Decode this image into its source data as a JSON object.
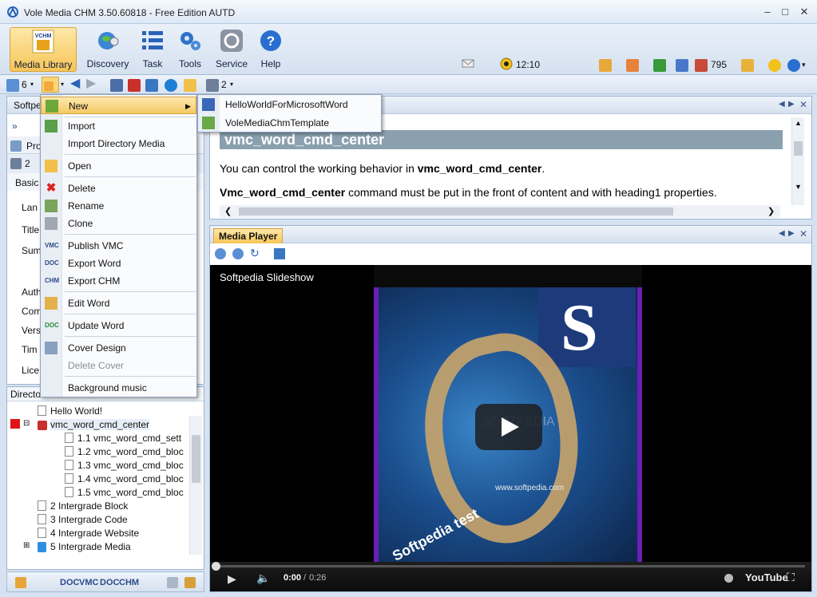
{
  "window": {
    "title": "Vole Media CHM  3.50.60818 - Free Edition AUTD"
  },
  "ribbon": {
    "buttons": [
      {
        "label": "Media Library"
      },
      {
        "label": "Discovery"
      },
      {
        "label": "Task"
      },
      {
        "label": "Tools"
      },
      {
        "label": "Service"
      },
      {
        "label": "Help"
      }
    ],
    "logo_text": "VCHM",
    "status": {
      "time": "12:10",
      "count": "795"
    }
  },
  "toolbar": {
    "count1": "6",
    "count2": "2"
  },
  "left_panel": {
    "header": "Softpe",
    "tab_label": "Pro",
    "tab_count": "2",
    "section": "Basic",
    "labels": [
      "Lan",
      "Title",
      "Sum",
      "Auth",
      "Com",
      "Vers",
      "Tim",
      "Lice"
    ]
  },
  "context_menu": {
    "items": [
      {
        "label": "New",
        "highlighted": true,
        "has_submenu": true
      },
      {
        "label": "Import"
      },
      {
        "label": "Import Directory Media"
      },
      {
        "label": "Open"
      },
      {
        "label": "Delete"
      },
      {
        "label": "Rename"
      },
      {
        "label": "Clone"
      },
      {
        "label": "Publish VMC"
      },
      {
        "label": "Export Word"
      },
      {
        "label": "Export CHM"
      },
      {
        "label": "Edit Word"
      },
      {
        "label": "Update Word"
      },
      {
        "label": "Cover Design"
      },
      {
        "label": "Delete Cover",
        "disabled": true
      },
      {
        "label": "Background music"
      }
    ],
    "icon_texts": [
      "VMC",
      "DOC",
      "CHM",
      "DOC"
    ],
    "submenu": [
      {
        "label": "HelloWorldForMicrosoftWord"
      },
      {
        "label": "VoleMediaChmTemplate"
      }
    ]
  },
  "directory": {
    "header": "Directo",
    "rows": [
      {
        "label": "Hello World!"
      },
      {
        "label": "vmc_word_cmd_center"
      },
      {
        "label": "1.1 vmc_word_cmd_sett"
      },
      {
        "label": "1.2 vmc_word_cmd_bloc"
      },
      {
        "label": "1.3 vmc_word_cmd_bloc"
      },
      {
        "label": "1.4 vmc_word_cmd_bloc"
      },
      {
        "label": "1.5 vmc_word_cmd_bloc"
      },
      {
        "label": "2 Intergrade Block"
      },
      {
        "label": "3 Intergrade Code"
      },
      {
        "label": "4 Intergrade Website"
      },
      {
        "label": "5 Intergrade Media"
      }
    ]
  },
  "left_bottom": {
    "buttons": [
      "VMC",
      "DOC",
      "CHM",
      "DOC"
    ]
  },
  "document": {
    "heading": "vmc_word_cmd_center",
    "p1_prefix": "You can control the working behavior in ",
    "p1_bold": "vmc_word_cmd_center",
    "p1_suffix": ".",
    "p2_bold": "Vmc_word_cmd_center",
    "p2_suffix": " command must be put in the front of content and with heading1 properties."
  },
  "media_player": {
    "tab": "Media Player",
    "video_title": "Softpedia Slideshow",
    "slide_letter": "S",
    "slide_caption": "Softpedia test",
    "slide_url": "www.softpedia.com",
    "watermark": "SOFTPEDIA",
    "time_current": "0:00",
    "time_sep": " / ",
    "time_total": "0:26",
    "youtube": "YouTube"
  },
  "colors": {
    "accent": "#f6c557",
    "heading_bar": "#8aa0af",
    "panel_border": "#9fb4cf"
  }
}
